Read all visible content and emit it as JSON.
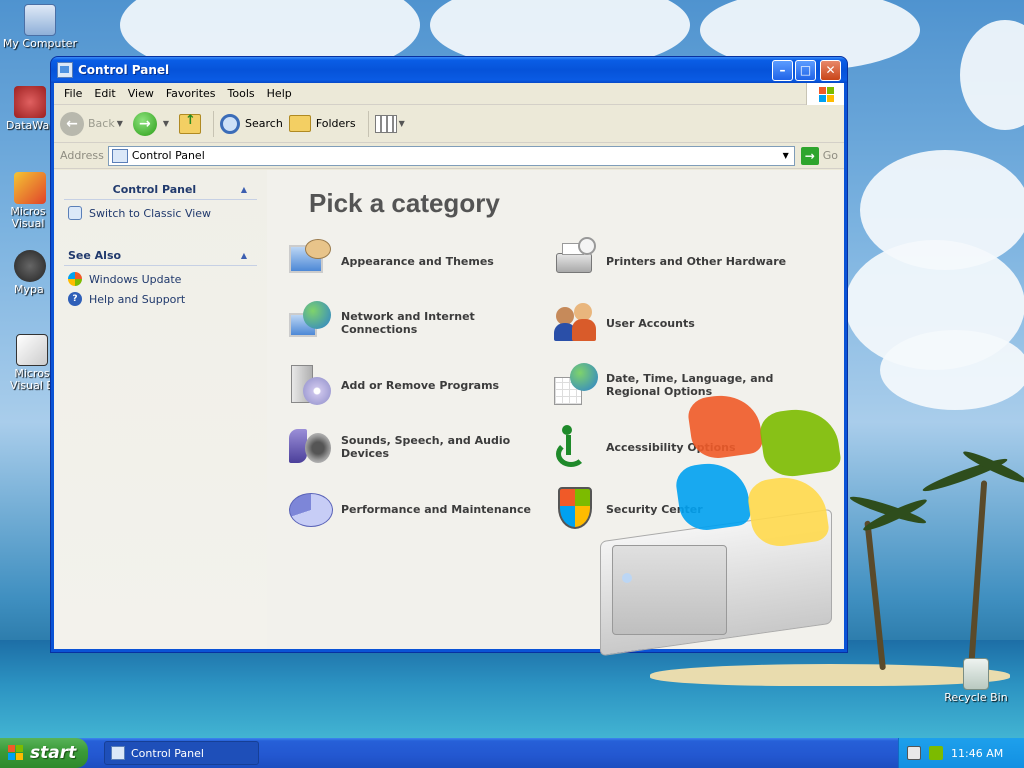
{
  "desktop": {
    "icons": [
      {
        "label": "My Computer",
        "icon": "my-computer-icon"
      },
      {
        "label": "DataWa",
        "icon": "datawa-shortcut-icon"
      },
      {
        "label": "Micros Visual",
        "icon": "microsoft-visual-shortcut-icon"
      },
      {
        "label": "Mypa",
        "icon": "mypa-shortcut-icon"
      },
      {
        "label": "Micros Visual B",
        "icon": "microsoft-visual-b-shortcut-icon"
      },
      {
        "label": "Recycle Bin",
        "icon": "recycle-bin-icon"
      }
    ]
  },
  "window": {
    "title": "Control Panel",
    "menu": [
      "File",
      "Edit",
      "View",
      "Favorites",
      "Tools",
      "Help"
    ],
    "toolbar": {
      "back_label": "Back",
      "search_label": "Search",
      "folders_label": "Folders"
    },
    "address": {
      "label": "Address",
      "value": "Control Panel",
      "go_label": "Go"
    },
    "taskpane": {
      "section1": {
        "title": "Control Panel",
        "links": [
          {
            "label": "Switch to Classic View",
            "icon": "classic-view-icon"
          }
        ]
      },
      "section2": {
        "title": "See Also",
        "links": [
          {
            "label": "Windows Update",
            "icon": "windows-update-icon"
          },
          {
            "label": "Help and Support",
            "icon": "help-support-icon"
          }
        ]
      }
    },
    "main": {
      "heading": "Pick a category",
      "categories": [
        {
          "label": "Appearance and Themes",
          "icon": "appearance-themes-icon"
        },
        {
          "label": "Printers and Other Hardware",
          "icon": "printer-icon"
        },
        {
          "label": "Network and Internet Connections",
          "icon": "network-globe-icon"
        },
        {
          "label": "User Accounts",
          "icon": "user-accounts-icon"
        },
        {
          "label": "Add or Remove Programs",
          "icon": "add-remove-programs-icon"
        },
        {
          "label": "Date, Time, Language, and Regional Options",
          "icon": "date-time-globe-icon"
        },
        {
          "label": "Sounds, Speech, and Audio Devices",
          "icon": "speaker-icon"
        },
        {
          "label": "Accessibility Options",
          "icon": "accessibility-icon"
        },
        {
          "label": "Performance and Maintenance",
          "icon": "performance-pie-icon"
        },
        {
          "label": "Security Center",
          "icon": "security-shield-icon"
        }
      ]
    }
  },
  "taskbar": {
    "start_label": "start",
    "tasks": [
      {
        "label": "Control Panel"
      }
    ],
    "clock": "11:46 AM"
  }
}
